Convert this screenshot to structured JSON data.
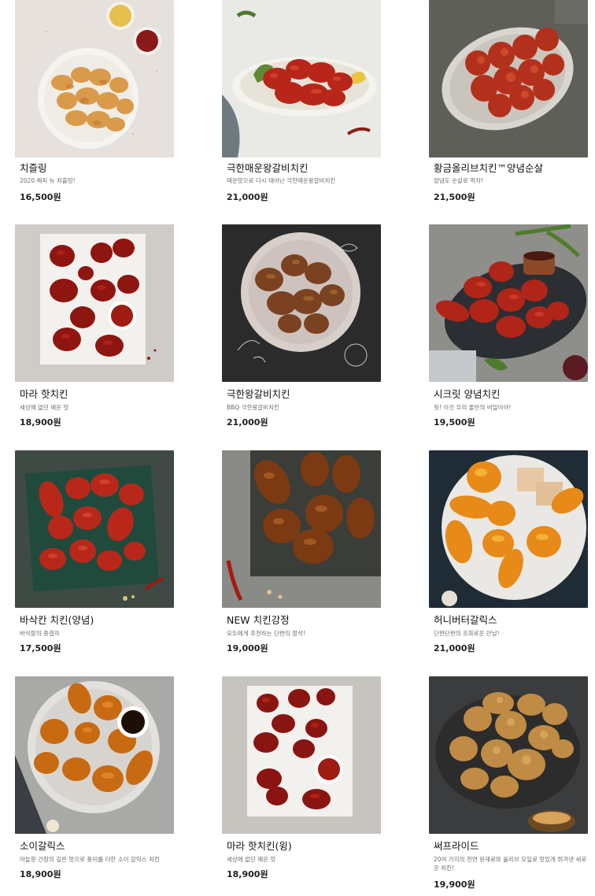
{
  "products": [
    {
      "name": "치즐링",
      "description": "2020 해피 뉴 치즐링!",
      "price": "16,500원"
    },
    {
      "name": "극한매운왕갈비치킨",
      "description": "매운맛으로 다시 태어난 극한매운왕갈비치킨",
      "price": "21,000원"
    },
    {
      "name": "황금올리브치킨™양념순살",
      "description": "양념도 순살로 먹자!",
      "price": "21,500원"
    },
    {
      "name": "마라 핫치킨",
      "description": "세상에 없던 매운 맛",
      "price": "18,900원"
    },
    {
      "name": "극한왕갈비치킨",
      "description": "BBQ 극한왕갈비치킨",
      "price": "21,000원"
    },
    {
      "name": "시크릿 양념치킨",
      "description": "헛! 이건 우리 둘만의 비밀이야!",
      "price": "19,500원"
    },
    {
      "name": "바삭칸 치킨(양념)",
      "description": "바삭함의 종결자",
      "price": "17,500원"
    },
    {
      "name": "NEW 치킨강정",
      "description": "모두에게 추천하는 단짠의 정석!",
      "price": "19,000원"
    },
    {
      "name": "허니버터갈릭스",
      "description": "단짠단짠의 조화로운 만남!",
      "price": "21,000원"
    },
    {
      "name": "소이갈릭스",
      "description": "마늘향 간장의 깊은 맛으로 풍미를 더한 소이 갈릭스 치킨",
      "price": "18,900원"
    },
    {
      "name": "마라 핫치킨(윙)",
      "description": "세상에 없던 매운 맛",
      "price": "18,900원"
    },
    {
      "name": "써프라이드",
      "description": "20여 가지의 천연 원재료와 올리브 오일로 맛있게 튀겨낸 새로운 치킨!",
      "price": "19,900원"
    }
  ]
}
